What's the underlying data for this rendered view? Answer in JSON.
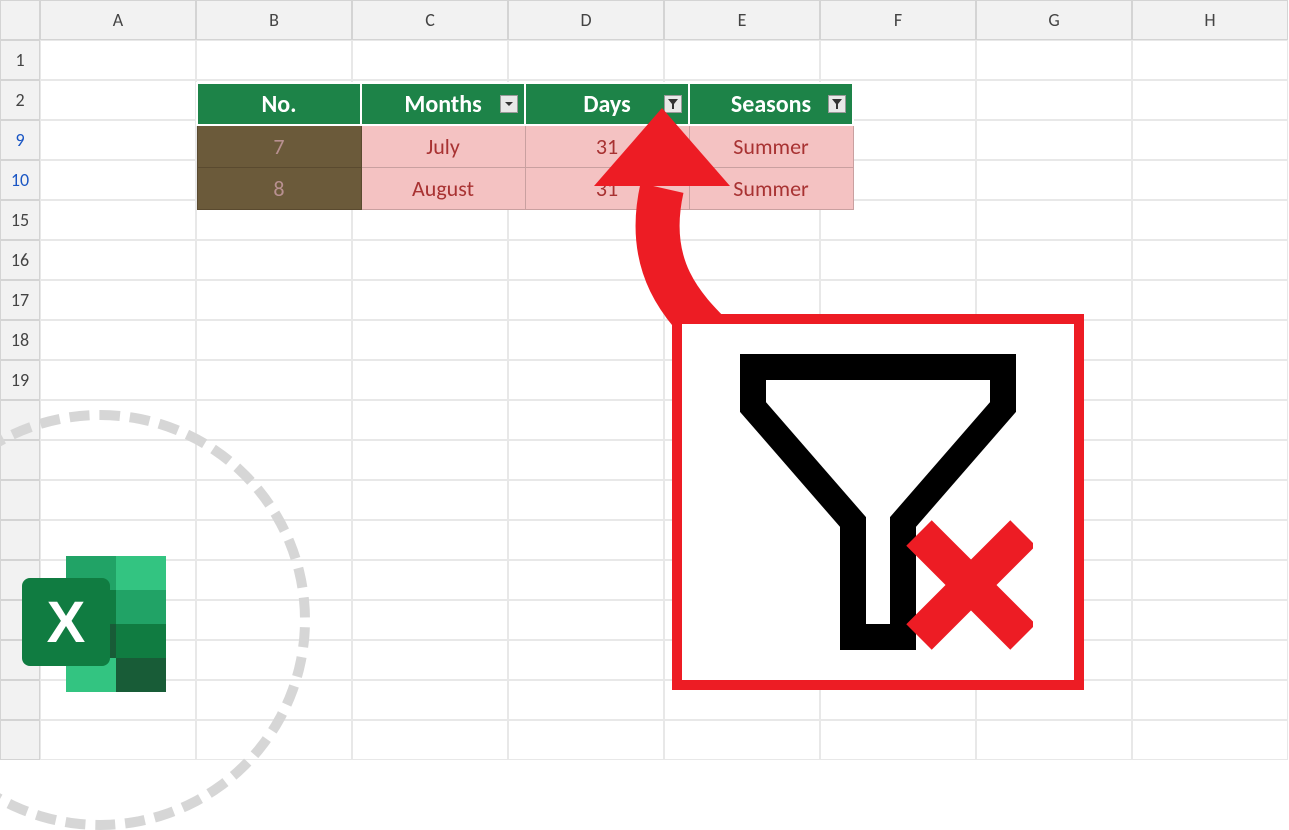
{
  "columns": [
    "A",
    "B",
    "C",
    "D",
    "E",
    "F",
    "G",
    "H"
  ],
  "visibleRows": [
    "1",
    "2",
    "9",
    "10",
    "15",
    "16",
    "17",
    "18",
    "19"
  ],
  "filteredRows": [
    "9",
    "10"
  ],
  "table": {
    "headers": [
      {
        "label": "No.",
        "hasDropdown": false,
        "filterActive": false
      },
      {
        "label": "Months",
        "hasDropdown": true,
        "filterActive": false
      },
      {
        "label": "Days",
        "hasDropdown": true,
        "filterActive": true
      },
      {
        "label": "Seasons",
        "hasDropdown": true,
        "filterActive": true
      }
    ],
    "rows": [
      {
        "no": "7",
        "month": "July",
        "days": "31",
        "season": "Summer"
      },
      {
        "no": "8",
        "month": "August",
        "days": "31",
        "season": "Summer"
      }
    ]
  },
  "icons": {
    "excelLetter": "X"
  }
}
